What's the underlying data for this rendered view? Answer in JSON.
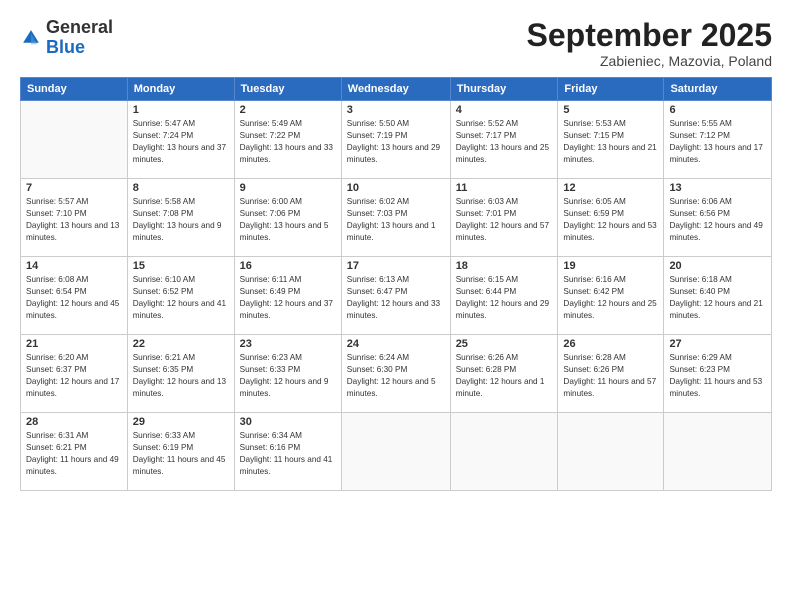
{
  "logo": {
    "general": "General",
    "blue": "Blue"
  },
  "title": "September 2025",
  "subtitle": "Zabieniec, Mazovia, Poland",
  "days_header": [
    "Sunday",
    "Monday",
    "Tuesday",
    "Wednesday",
    "Thursday",
    "Friday",
    "Saturday"
  ],
  "weeks": [
    [
      {
        "day": "",
        "sunrise": "",
        "sunset": "",
        "daylight": ""
      },
      {
        "day": "1",
        "sunrise": "Sunrise: 5:47 AM",
        "sunset": "Sunset: 7:24 PM",
        "daylight": "Daylight: 13 hours and 37 minutes."
      },
      {
        "day": "2",
        "sunrise": "Sunrise: 5:49 AM",
        "sunset": "Sunset: 7:22 PM",
        "daylight": "Daylight: 13 hours and 33 minutes."
      },
      {
        "day": "3",
        "sunrise": "Sunrise: 5:50 AM",
        "sunset": "Sunset: 7:19 PM",
        "daylight": "Daylight: 13 hours and 29 minutes."
      },
      {
        "day": "4",
        "sunrise": "Sunrise: 5:52 AM",
        "sunset": "Sunset: 7:17 PM",
        "daylight": "Daylight: 13 hours and 25 minutes."
      },
      {
        "day": "5",
        "sunrise": "Sunrise: 5:53 AM",
        "sunset": "Sunset: 7:15 PM",
        "daylight": "Daylight: 13 hours and 21 minutes."
      },
      {
        "day": "6",
        "sunrise": "Sunrise: 5:55 AM",
        "sunset": "Sunset: 7:12 PM",
        "daylight": "Daylight: 13 hours and 17 minutes."
      }
    ],
    [
      {
        "day": "7",
        "sunrise": "Sunrise: 5:57 AM",
        "sunset": "Sunset: 7:10 PM",
        "daylight": "Daylight: 13 hours and 13 minutes."
      },
      {
        "day": "8",
        "sunrise": "Sunrise: 5:58 AM",
        "sunset": "Sunset: 7:08 PM",
        "daylight": "Daylight: 13 hours and 9 minutes."
      },
      {
        "day": "9",
        "sunrise": "Sunrise: 6:00 AM",
        "sunset": "Sunset: 7:06 PM",
        "daylight": "Daylight: 13 hours and 5 minutes."
      },
      {
        "day": "10",
        "sunrise": "Sunrise: 6:02 AM",
        "sunset": "Sunset: 7:03 PM",
        "daylight": "Daylight: 13 hours and 1 minute."
      },
      {
        "day": "11",
        "sunrise": "Sunrise: 6:03 AM",
        "sunset": "Sunset: 7:01 PM",
        "daylight": "Daylight: 12 hours and 57 minutes."
      },
      {
        "day": "12",
        "sunrise": "Sunrise: 6:05 AM",
        "sunset": "Sunset: 6:59 PM",
        "daylight": "Daylight: 12 hours and 53 minutes."
      },
      {
        "day": "13",
        "sunrise": "Sunrise: 6:06 AM",
        "sunset": "Sunset: 6:56 PM",
        "daylight": "Daylight: 12 hours and 49 minutes."
      }
    ],
    [
      {
        "day": "14",
        "sunrise": "Sunrise: 6:08 AM",
        "sunset": "Sunset: 6:54 PM",
        "daylight": "Daylight: 12 hours and 45 minutes."
      },
      {
        "day": "15",
        "sunrise": "Sunrise: 6:10 AM",
        "sunset": "Sunset: 6:52 PM",
        "daylight": "Daylight: 12 hours and 41 minutes."
      },
      {
        "day": "16",
        "sunrise": "Sunrise: 6:11 AM",
        "sunset": "Sunset: 6:49 PM",
        "daylight": "Daylight: 12 hours and 37 minutes."
      },
      {
        "day": "17",
        "sunrise": "Sunrise: 6:13 AM",
        "sunset": "Sunset: 6:47 PM",
        "daylight": "Daylight: 12 hours and 33 minutes."
      },
      {
        "day": "18",
        "sunrise": "Sunrise: 6:15 AM",
        "sunset": "Sunset: 6:44 PM",
        "daylight": "Daylight: 12 hours and 29 minutes."
      },
      {
        "day": "19",
        "sunrise": "Sunrise: 6:16 AM",
        "sunset": "Sunset: 6:42 PM",
        "daylight": "Daylight: 12 hours and 25 minutes."
      },
      {
        "day": "20",
        "sunrise": "Sunrise: 6:18 AM",
        "sunset": "Sunset: 6:40 PM",
        "daylight": "Daylight: 12 hours and 21 minutes."
      }
    ],
    [
      {
        "day": "21",
        "sunrise": "Sunrise: 6:20 AM",
        "sunset": "Sunset: 6:37 PM",
        "daylight": "Daylight: 12 hours and 17 minutes."
      },
      {
        "day": "22",
        "sunrise": "Sunrise: 6:21 AM",
        "sunset": "Sunset: 6:35 PM",
        "daylight": "Daylight: 12 hours and 13 minutes."
      },
      {
        "day": "23",
        "sunrise": "Sunrise: 6:23 AM",
        "sunset": "Sunset: 6:33 PM",
        "daylight": "Daylight: 12 hours and 9 minutes."
      },
      {
        "day": "24",
        "sunrise": "Sunrise: 6:24 AM",
        "sunset": "Sunset: 6:30 PM",
        "daylight": "Daylight: 12 hours and 5 minutes."
      },
      {
        "day": "25",
        "sunrise": "Sunrise: 6:26 AM",
        "sunset": "Sunset: 6:28 PM",
        "daylight": "Daylight: 12 hours and 1 minute."
      },
      {
        "day": "26",
        "sunrise": "Sunrise: 6:28 AM",
        "sunset": "Sunset: 6:26 PM",
        "daylight": "Daylight: 11 hours and 57 minutes."
      },
      {
        "day": "27",
        "sunrise": "Sunrise: 6:29 AM",
        "sunset": "Sunset: 6:23 PM",
        "daylight": "Daylight: 11 hours and 53 minutes."
      }
    ],
    [
      {
        "day": "28",
        "sunrise": "Sunrise: 6:31 AM",
        "sunset": "Sunset: 6:21 PM",
        "daylight": "Daylight: 11 hours and 49 minutes."
      },
      {
        "day": "29",
        "sunrise": "Sunrise: 6:33 AM",
        "sunset": "Sunset: 6:19 PM",
        "daylight": "Daylight: 11 hours and 45 minutes."
      },
      {
        "day": "30",
        "sunrise": "Sunrise: 6:34 AM",
        "sunset": "Sunset: 6:16 PM",
        "daylight": "Daylight: 11 hours and 41 minutes."
      },
      {
        "day": "",
        "sunrise": "",
        "sunset": "",
        "daylight": ""
      },
      {
        "day": "",
        "sunrise": "",
        "sunset": "",
        "daylight": ""
      },
      {
        "day": "",
        "sunrise": "",
        "sunset": "",
        "daylight": ""
      },
      {
        "day": "",
        "sunrise": "",
        "sunset": "",
        "daylight": ""
      }
    ]
  ]
}
